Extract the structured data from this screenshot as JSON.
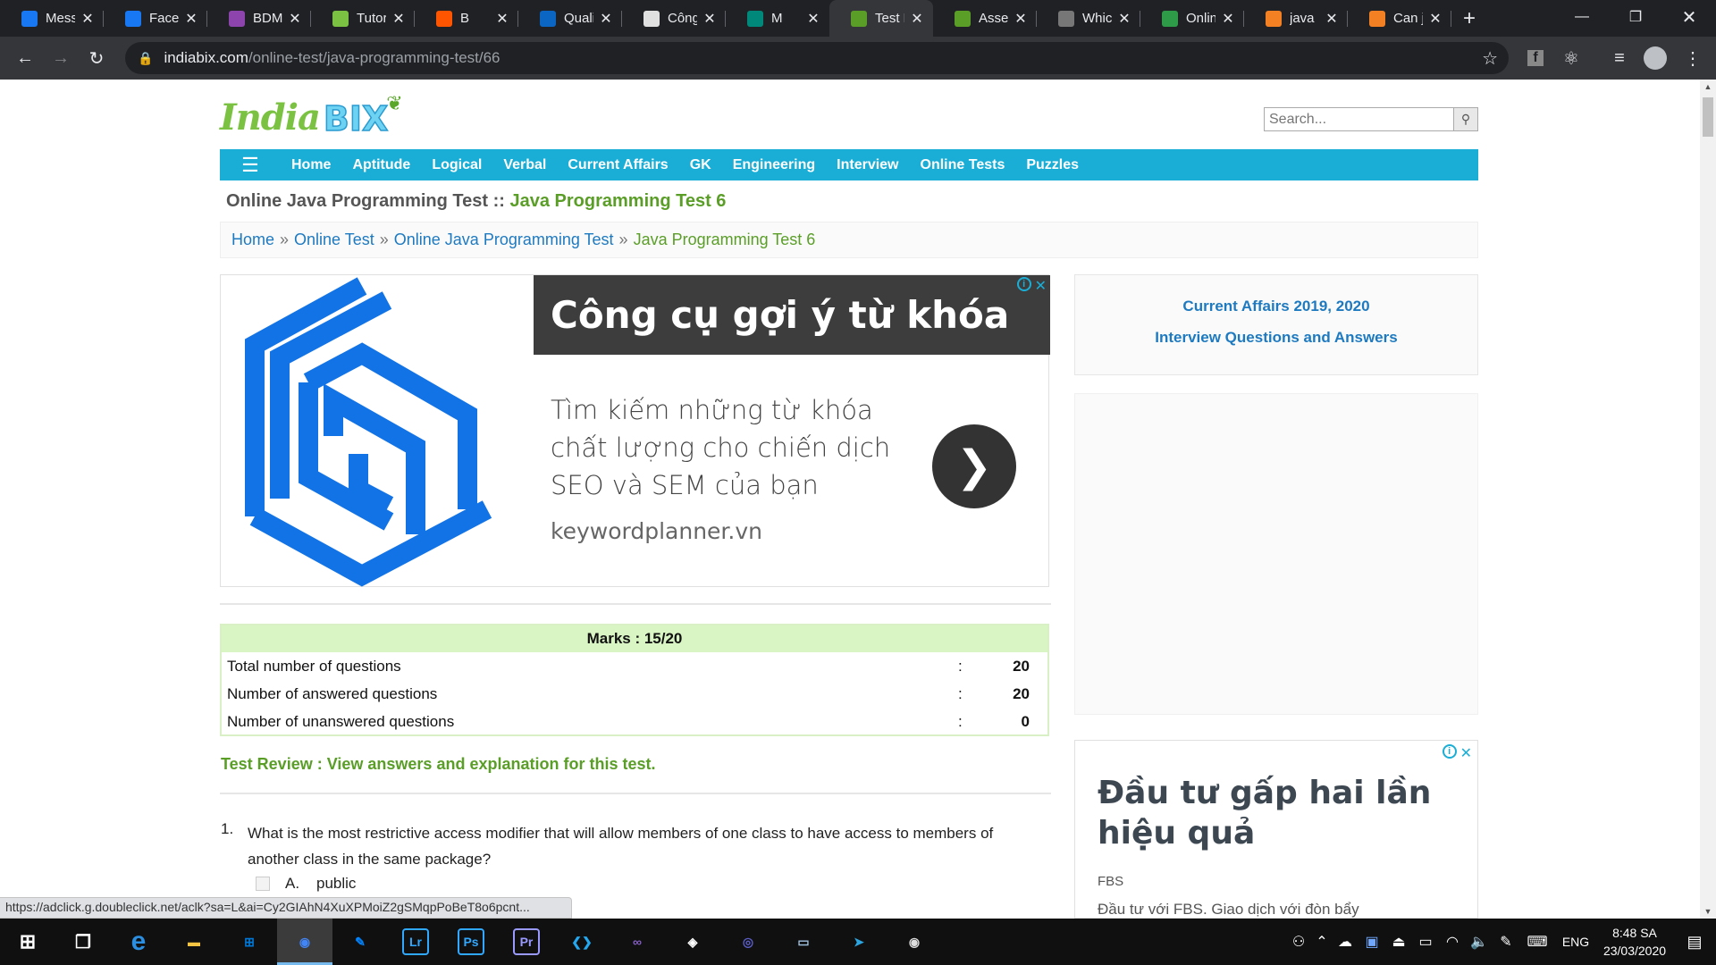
{
  "tabs": [
    {
      "label": "Messenger",
      "icon": "messenger-icon",
      "color": "#1877f2"
    },
    {
      "label": "Facebook",
      "icon": "facebook-icon",
      "color": "#1877f2"
    },
    {
      "label": "BDM",
      "icon": "bdm-icon",
      "color": "#8e44ad"
    },
    {
      "label": "Tutorial",
      "icon": "leaf-icon",
      "color": "#7cc242"
    },
    {
      "label": "B",
      "icon": "soundcloud-icon",
      "color": "#ff5500"
    },
    {
      "label": "Quality",
      "icon": "linkedin-icon",
      "color": "#0a66c2"
    },
    {
      "label": "Công",
      "icon": "doc-icon",
      "color": "#e0e0e0"
    },
    {
      "label": "M",
      "icon": "meet-icon",
      "color": "#00897b"
    },
    {
      "label": "Test R",
      "icon": "indiabix-icon",
      "color": "#5a9e28"
    },
    {
      "label": "Asser",
      "icon": "indiabix-icon",
      "color": "#5a9e28"
    },
    {
      "label": "Which",
      "icon": "globe-icon",
      "color": "#777777"
    },
    {
      "label": "Online",
      "icon": "code-icon",
      "color": "#2e9b48"
    },
    {
      "label": "java",
      "icon": "stackoverflow-icon",
      "color": "#f48024"
    },
    {
      "label": "Can j",
      "icon": "stackoverflow-icon",
      "color": "#f48024"
    }
  ],
  "address": {
    "host": "indiabix.com",
    "path": "/online-test/java-programming-test/66"
  },
  "search": {
    "placeholder": "Search..."
  },
  "nav": [
    "Home",
    "Aptitude",
    "Logical",
    "Verbal",
    "Current Affairs",
    "GK",
    "Engineering",
    "Interview",
    "Online Tests",
    "Puzzles"
  ],
  "page_title": {
    "prefix": "Online Java Programming Test :: ",
    "highlight": "Java Programming Test 6"
  },
  "breadcrumb": {
    "home": "Home",
    "online_test": "Online Test",
    "java_test": "Online Java Programming Test",
    "current": "Java Programming Test 6",
    "separator": "»"
  },
  "ad1": {
    "headline": "Công cụ gợi ý từ khóa",
    "description": "Tìm kiếm những từ khóa chất lượng cho chiến dịch SEO và SEM của bạn",
    "domain": "keywordplanner.vn"
  },
  "results": {
    "marks": "Marks : 15/20",
    "rows": [
      {
        "label": "Total number of questions",
        "value": "20"
      },
      {
        "label": "Number of answered questions",
        "value": "20"
      },
      {
        "label": "Number of unanswered questions",
        "value": "0"
      }
    ]
  },
  "review_link": "Test Review : View answers and explanation for this test.",
  "question": {
    "number": "1.",
    "text": "What is the most restrictive access modifier that will allow members of one class to have access to members of another class in the same package?",
    "option_letter": "A.",
    "option_text": "public"
  },
  "sidebar": {
    "link1": "Current Affairs 2019, 2020",
    "link2": "Interview Questions and Answers"
  },
  "ad2": {
    "headline": "Đầu tư gấp hai lần hiệu quả",
    "brand": "FBS",
    "subtext": "Đầu tư với FBS. Giao dịch với đòn bẩy"
  },
  "status_url": "https://adclick.g.doubleclick.net/aclk?sa=L&ai=Cy2GIAhN4XuXPMoiZ2gSMqpPoBeT8o6pcnt...",
  "taskbar": {
    "apps": [
      {
        "name": "file-explorer",
        "color": "#f4c542",
        "glyph": "▬"
      },
      {
        "name": "store",
        "color": "#0078d7",
        "glyph": "⊞"
      },
      {
        "name": "chrome",
        "color": "#4285f4",
        "glyph": "◉"
      },
      {
        "name": "messenger",
        "color": "#0084ff",
        "glyph": "✎"
      },
      {
        "name": "lightroom",
        "color": "#31a8ff",
        "glyph": "Lr"
      },
      {
        "name": "photoshop",
        "color": "#31a8ff",
        "glyph": "Ps"
      },
      {
        "name": "premiere",
        "color": "#9999ff",
        "glyph": "Pr"
      },
      {
        "name": "vscode",
        "color": "#23a9f2",
        "glyph": "❮❯"
      },
      {
        "name": "visual-studio",
        "color": "#865fc5",
        "glyph": "∞"
      },
      {
        "name": "unity",
        "color": "#ffffff",
        "glyph": "◈"
      },
      {
        "name": "cd-player",
        "color": "#5b5ec7",
        "glyph": "◎"
      },
      {
        "name": "photos",
        "color": "#a0c0e0",
        "glyph": "▭"
      },
      {
        "name": "telegram",
        "color": "#2ca5e0",
        "glyph": "➤"
      },
      {
        "name": "obs",
        "color": "#dddddd",
        "glyph": "◉"
      }
    ],
    "language": "ENG",
    "time": "8:48 SA",
    "date": "23/03/2020"
  }
}
